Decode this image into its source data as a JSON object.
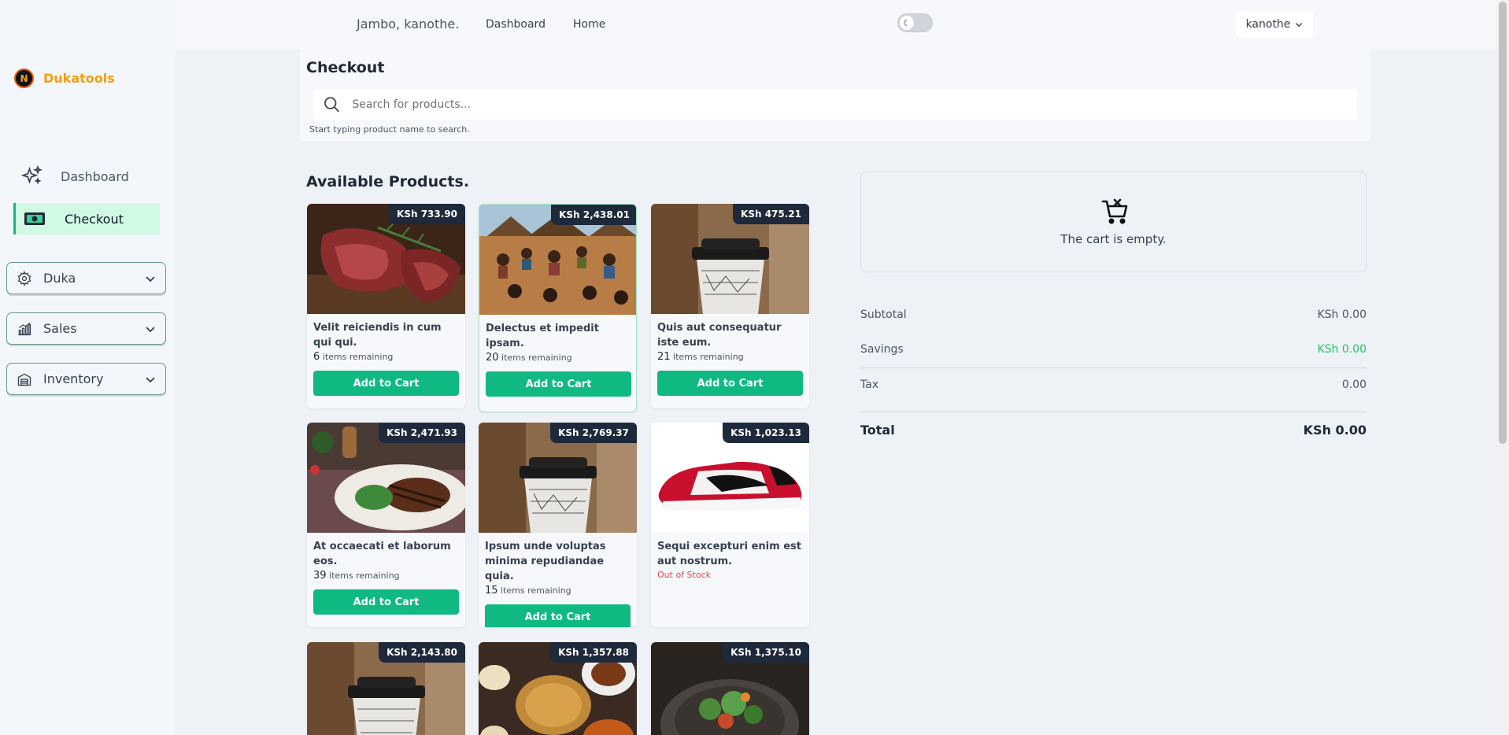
{
  "brand": {
    "logo_letter": "N",
    "name": "Dukatools",
    "accent": "#f59e0b"
  },
  "sidebar": {
    "links": [
      {
        "label": "Dashboard",
        "icon": "sparkles-icon"
      },
      {
        "label": "Checkout",
        "icon": "cash-icon",
        "active": true
      }
    ],
    "groups": [
      {
        "label": "Duka",
        "icon": "gear-icon"
      },
      {
        "label": "Sales",
        "icon": "bar-chart-icon"
      },
      {
        "label": "Inventory",
        "icon": "warehouse-icon"
      }
    ]
  },
  "topbar": {
    "greeting": "Jambo, kanothe.",
    "links": [
      "Dashboard",
      "Home"
    ],
    "theme_toggle_icon": "moon-icon",
    "user": "kanothe"
  },
  "checkout": {
    "title": "Checkout",
    "search_placeholder": "Search for products...",
    "search_hint": "Start typing product name to search."
  },
  "products_title": "Available Products.",
  "products": [
    {
      "price": "KSh 733.90",
      "name": "Velit reiciendis in cum qui qui.",
      "stock": "6",
      "stock_label": "items remaining",
      "button": "Add to Cart",
      "image": "steak"
    },
    {
      "price": "KSh 2,438.01",
      "name": "Delectus et impedit ipsam.",
      "stock": "20",
      "stock_label": "items remaining",
      "button": "Add to Cart",
      "image": "village"
    },
    {
      "price": "KSh 475.21",
      "name": "Quis aut consequatur iste eum.",
      "stock": "21",
      "stock_label": "items remaining",
      "button": "Add to Cart",
      "image": "coffee"
    },
    {
      "price": "KSh 2,471.93",
      "name": "At occaecati et laborum eos.",
      "stock": "39",
      "stock_label": "items remaining",
      "button": "Add to Cart",
      "image": "plate"
    },
    {
      "price": "KSh 2,769.37",
      "name": "Ipsum unde voluptas minima repudiandae quia.",
      "stock": "15",
      "stock_label": "items remaining",
      "button": "Add to Cart",
      "image": "coffee"
    },
    {
      "price": "KSh 1,023.13",
      "name": "Sequi excepturi enim est aut nostrum.",
      "status": "Out of Stock",
      "image": "sneaker"
    },
    {
      "price": "KSh 2,143.80",
      "image": "coffee"
    },
    {
      "price": "KSh 1,357.88",
      "image": "feast"
    },
    {
      "price": "KSh 1,375.10",
      "image": "salad"
    }
  ],
  "cart": {
    "empty_message": "The cart is empty.",
    "icon": "cart-x-icon",
    "subtotal_label": "Subtotal",
    "subtotal": "KSh 0.00",
    "savings_label": "Savings",
    "savings": "KSh 0.00",
    "tax_label": "Tax",
    "tax": "0.00",
    "total_label": "Total",
    "total": "KSh 0.00"
  }
}
